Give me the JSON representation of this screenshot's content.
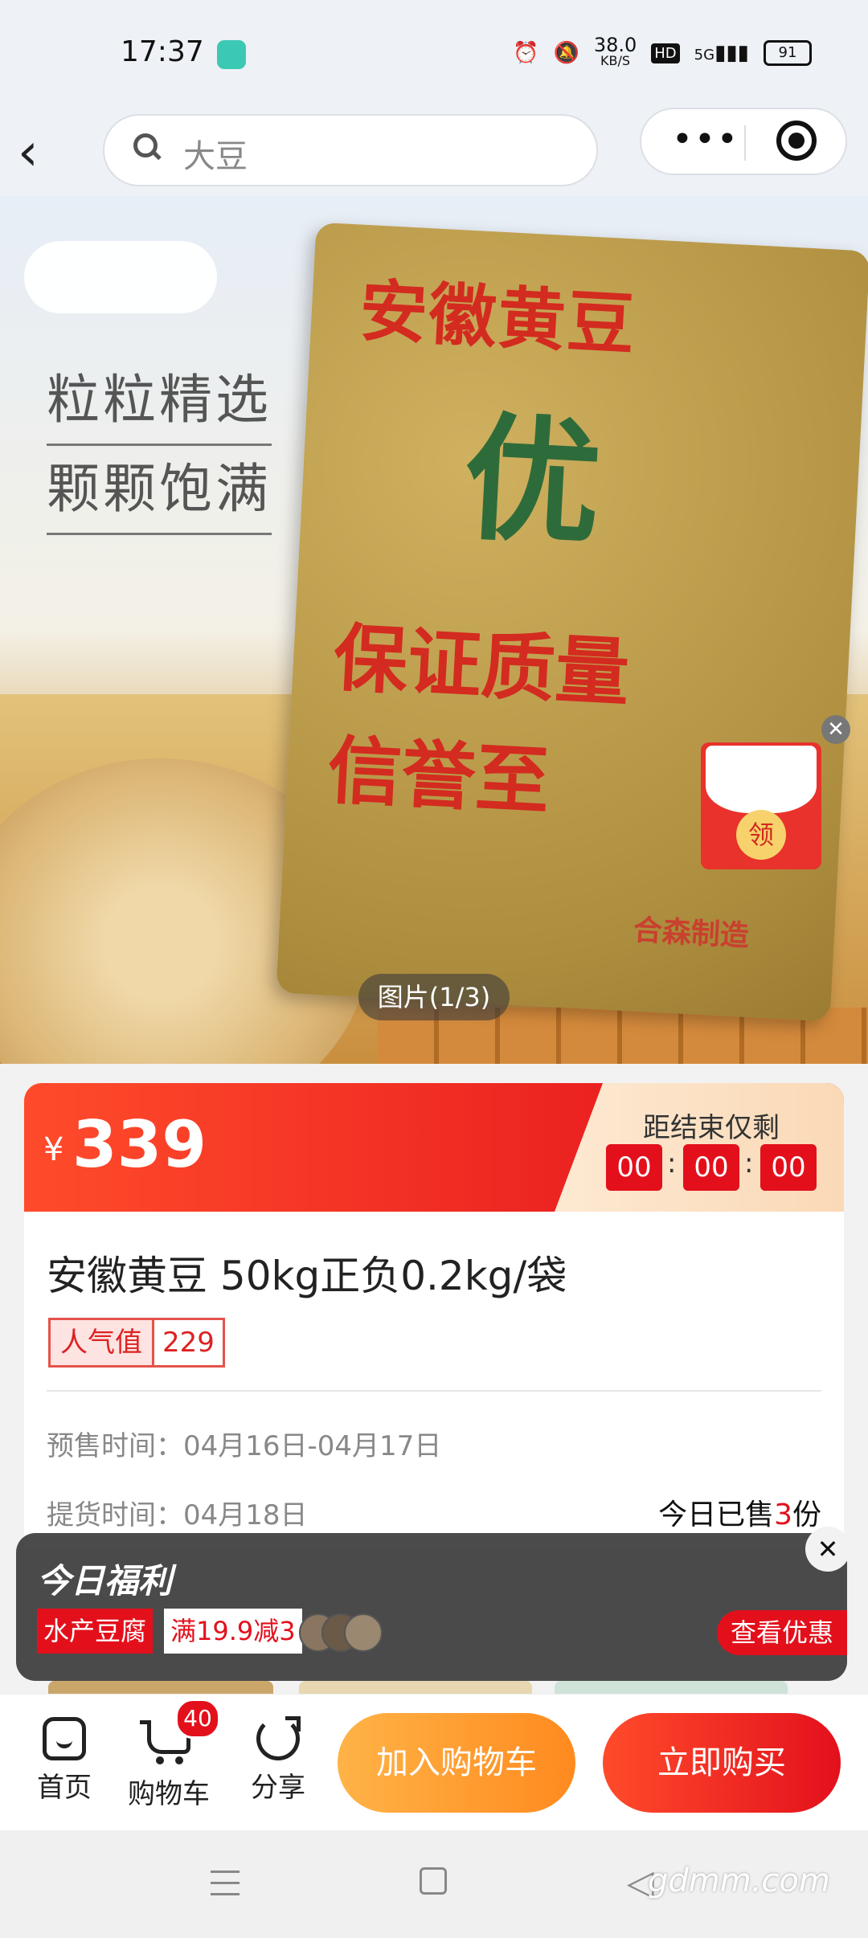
{
  "status_bar": {
    "time": "17:37",
    "net_speed_value": "38.0",
    "net_speed_unit": "KB/S",
    "hd_label": "HD",
    "signal_label": "5G",
    "battery": "91"
  },
  "header": {
    "search_text": "大豆"
  },
  "product_image": {
    "side_text_line1": "粒粒精选",
    "side_text_line2": "颗颗饱满",
    "sack_line1": "安徽黄豆",
    "sack_line2": "优",
    "sack_line3": "保证质量",
    "sack_line4": "信誉至",
    "sack_maker": "合森制造",
    "counter": "图片(1/3)",
    "coupon_label": "领"
  },
  "price_bar": {
    "currency": "¥",
    "price": "339",
    "countdown_label": "距结束仅剩",
    "hours": "00",
    "minutes": "00",
    "seconds": "00",
    "separator": ":"
  },
  "info": {
    "title": "安徽黄豆 50kg正负0.2kg/袋",
    "popularity_label": "人气值",
    "popularity_value": "229",
    "presale_time": "预售时间：04月16日-04月17日",
    "pickup_time": "提货时间：04月18日",
    "sold_prefix": "今日已售",
    "sold_count": "3",
    "sold_suffix": "份"
  },
  "welfare_popup": {
    "title": "今日福利",
    "category": "水产豆腐",
    "deal": "满19.9减3",
    "button": "查看优惠",
    "close": "✕"
  },
  "bottom_bar": {
    "home_label": "首页",
    "cart_label": "购物车",
    "cart_count": "40",
    "share_label": "分享",
    "add_to_cart": "加入购物车",
    "buy_now": "立即购买"
  },
  "watermark": "gdmm.com"
}
